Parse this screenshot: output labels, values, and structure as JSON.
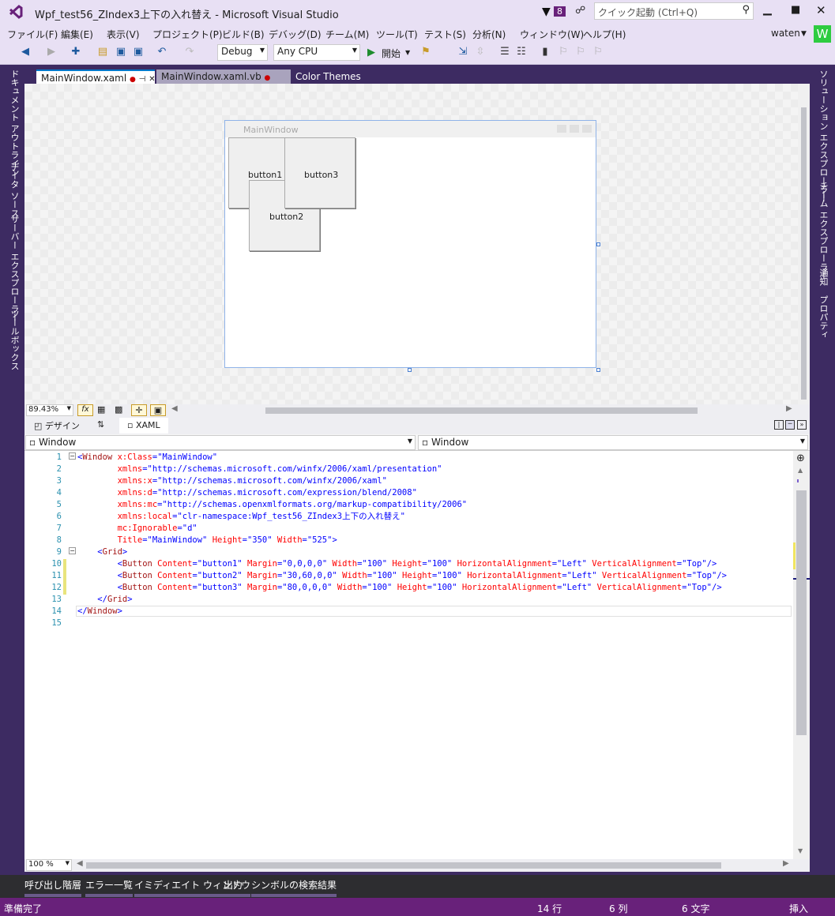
{
  "title": "Wpf_test56_ZIndex3上下の入れ替え - Microsoft Visual Studio",
  "notif_count": "8",
  "quick_launch_placeholder": "クイック起動 (Ctrl+Q)",
  "user": "waten",
  "user_initial": "W",
  "menu": [
    "ファイル(F)",
    "編集(E)",
    "表示(V)",
    "プロジェクト(P)",
    "ビルド(B)",
    "デバッグ(D)",
    "チーム(M)",
    "ツール(T)",
    "テスト(S)",
    "分析(N)",
    "ウィンドウ(W)",
    "ヘルプ(H)"
  ],
  "toolbar": {
    "config": "Debug",
    "platform": "Any CPU",
    "start": "開始"
  },
  "left_tabs": [
    "ドキュメント アウトライン",
    "データ ソース",
    "サーバー エクスプローラー",
    "ツールボックス"
  ],
  "right_tabs": [
    "ソリューション エクスプローラー",
    "チーム エクスプローラー",
    "通知",
    "プロパティ"
  ],
  "doc_tabs": [
    "MainWindow.xaml",
    "MainWindow.xaml.vb",
    "Color Themes"
  ],
  "designer": {
    "window_title": "MainWindow",
    "buttons": [
      "button1",
      "button2",
      "button3"
    ]
  },
  "zoom": "89.43%",
  "fx": "fx",
  "view_tabs": {
    "design": "デザイン",
    "swap": "⇅",
    "xaml": "XAML"
  },
  "nav_left": "Window",
  "nav_right": "Window",
  "code": [
    {
      "n": "1",
      "t": "<Window x:Class=\"MainWindow\""
    },
    {
      "n": "2",
      "t": "        xmlns=\"http://schemas.microsoft.com/winfx/2006/xaml/presentation\""
    },
    {
      "n": "3",
      "t": "        xmlns:x=\"http://schemas.microsoft.com/winfx/2006/xaml\""
    },
    {
      "n": "4",
      "t": "        xmlns:d=\"http://schemas.microsoft.com/expression/blend/2008\""
    },
    {
      "n": "5",
      "t": "        xmlns:mc=\"http://schemas.openxmlformats.org/markup-compatibility/2006\""
    },
    {
      "n": "6",
      "t": "        xmlns:local=\"clr-namespace:Wpf_test56_ZIndex3上下の入れ替え\""
    },
    {
      "n": "7",
      "t": "        mc:Ignorable=\"d\""
    },
    {
      "n": "8",
      "t": "        Title=\"MainWindow\" Height=\"350\" Width=\"525\">"
    },
    {
      "n": "9",
      "t": "    <Grid>"
    },
    {
      "n": "10",
      "t": "        <Button Content=\"button1\" Margin=\"0,0,0,0\" Width=\"100\" Height=\"100\" HorizontalAlignment=\"Left\" VerticalAlignment=\"Top\"/>"
    },
    {
      "n": "11",
      "t": "        <Button Content=\"button2\" Margin=\"30,60,0,0\" Width=\"100\" Height=\"100\" HorizontalAlignment=\"Left\" VerticalAlignment=\"Top\"/>"
    },
    {
      "n": "12",
      "t": "        <Button Content=\"button3\" Margin=\"80,0,0,0\" Width=\"100\" Height=\"100\" HorizontalAlignment=\"Left\" VerticalAlignment=\"Top\"/>"
    },
    {
      "n": "13",
      "t": "    </Grid>"
    },
    {
      "n": "14",
      "t": "</Window>"
    },
    {
      "n": "15",
      "t": ""
    }
  ],
  "code_zoom": "100 %",
  "bottom_tabs": [
    "呼び出し階層",
    "エラー一覧",
    "イミディエイト ウィンドウ",
    "出力",
    "シンボルの検索結果"
  ],
  "status": {
    "ready": "準備完了",
    "line": "14 行",
    "col": "6 列",
    "ch": "6 文字",
    "mode": "挿入"
  }
}
